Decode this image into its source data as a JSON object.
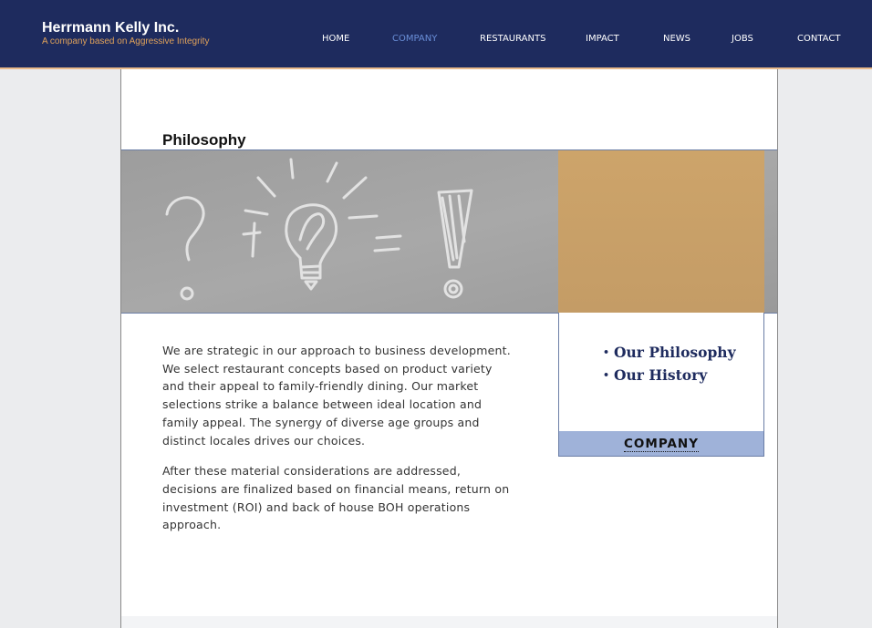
{
  "brand": {
    "name": "Herrmann Kelly Inc.",
    "tagline": "A company based on Aggressive Integrity"
  },
  "nav": {
    "items": [
      {
        "label": "HOME",
        "active": false
      },
      {
        "label": "COMPANY",
        "active": true
      },
      {
        "label": "RESTAURANTS",
        "active": false
      },
      {
        "label": "IMPACT",
        "active": false
      },
      {
        "label": "NEWS",
        "active": false
      },
      {
        "label": "JOBS",
        "active": false
      },
      {
        "label": "CONTACT",
        "active": false
      }
    ]
  },
  "page": {
    "title": "Philosophy",
    "paragraphs": [
      "We are strategic in our approach to business development. We select restaurant concepts based on product variety and their appeal to family-friendly dining. Our market selections strike a balance between ideal location and family appeal. The synergy of diverse age groups and distinct locales drives our choices.",
      "After these material considerations are addressed, decisions are finalized based on financial means, return on investment (ROI) and back of house BOH operations approach."
    ]
  },
  "sidebar": {
    "links": [
      "Our Philosophy",
      "Our History"
    ],
    "bullet": "•",
    "footer_label": "COMPANY"
  },
  "banner": {
    "icons": [
      "question-mark",
      "plus",
      "lightbulb",
      "equals",
      "exclamation-mark"
    ]
  },
  "colors": {
    "header_bg": "#1e2b5e",
    "nav_active": "#6a8fd8",
    "tagline": "#e0a25a",
    "sidebar_footer_bg": "#9fb2d9",
    "link_color": "#1e2b5e",
    "banner_gold": "#c9a46e"
  }
}
